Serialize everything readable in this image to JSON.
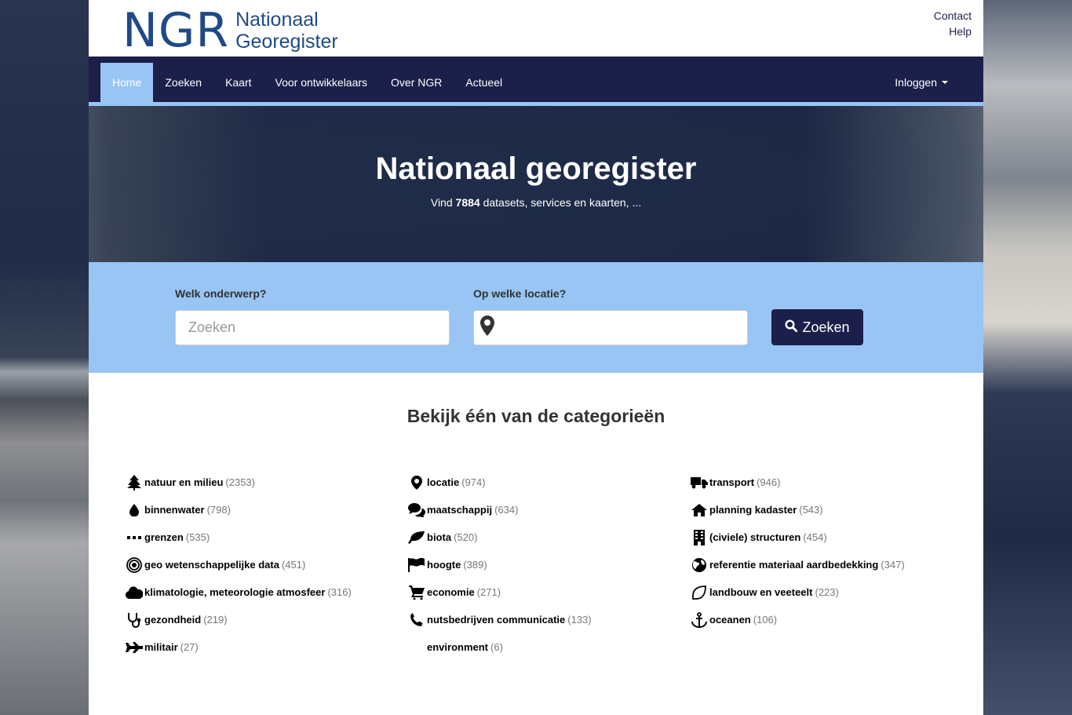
{
  "header": {
    "logo_short": "NGR",
    "logo_line1": "Nationaal",
    "logo_line2": "Georegister",
    "links": [
      "Contact",
      "Help"
    ]
  },
  "nav": {
    "items": [
      "Home",
      "Zoeken",
      "Kaart",
      "Voor ontwikkelaars",
      "Over NGR",
      "Actueel"
    ],
    "active": "Home",
    "login": "Inloggen"
  },
  "hero": {
    "title": "Nationaal georegister",
    "subtitle_prefix": "Vind",
    "count": "7884",
    "subtitle_suffix": "datasets, services en kaarten, ..."
  },
  "search": {
    "subject_label": "Welk onderwerp?",
    "subject_placeholder": "Zoeken",
    "location_label": "Op welke locatie?",
    "location_placeholder": "",
    "button": "Zoeken"
  },
  "categories": {
    "heading": "Bekijk één van de categorieën",
    "columns": [
      [
        {
          "icon": "tree-icon",
          "name": "natuur en milieu",
          "count": "(2353)"
        },
        {
          "icon": "drop-icon",
          "name": "binnenwater",
          "count": "(798)"
        },
        {
          "icon": "dots-icon",
          "name": "grenzen",
          "count": "(535)"
        },
        {
          "icon": "target-icon",
          "name": "geo wetenschappelijke data",
          "count": "(451)"
        },
        {
          "icon": "cloud-icon",
          "name": "klimatologie, meteorologie atmosfeer",
          "count": "(316)"
        },
        {
          "icon": "stethoscope-icon",
          "name": "gezondheid",
          "count": "(219)"
        },
        {
          "icon": "plane-icon",
          "name": "militair",
          "count": "(27)"
        }
      ],
      [
        {
          "icon": "map-marker-icon",
          "name": "locatie",
          "count": "(974)"
        },
        {
          "icon": "comments-icon",
          "name": "maatschappij",
          "count": "(634)"
        },
        {
          "icon": "leaf-icon",
          "name": "biota",
          "count": "(520)"
        },
        {
          "icon": "flag-icon",
          "name": "hoogte",
          "count": "(389)"
        },
        {
          "icon": "cart-icon",
          "name": "economie",
          "count": "(271)"
        },
        {
          "icon": "phone-icon",
          "name": "nutsbedrijven communicatie",
          "count": "(133)"
        },
        {
          "icon": "",
          "name": "environment",
          "count": "(6)"
        }
      ],
      [
        {
          "icon": "truck-icon",
          "name": "transport",
          "count": "(946)"
        },
        {
          "icon": "home-icon",
          "name": "planning kadaster",
          "count": "(543)"
        },
        {
          "icon": "building-icon",
          "name": "(civiele) structuren",
          "count": "(454)"
        },
        {
          "icon": "globe-icon",
          "name": "referentie materiaal aardbedekking",
          "count": "(347)"
        },
        {
          "icon": "leaf-outline-icon",
          "name": "landbouw en veeteelt",
          "count": "(223)"
        },
        {
          "icon": "anchor-icon",
          "name": "oceanen",
          "count": "(106)"
        }
      ]
    ]
  },
  "colors": {
    "navy": "#1b1f4a",
    "light_blue": "#98c5f4",
    "logo_blue": "#1f4a86"
  }
}
